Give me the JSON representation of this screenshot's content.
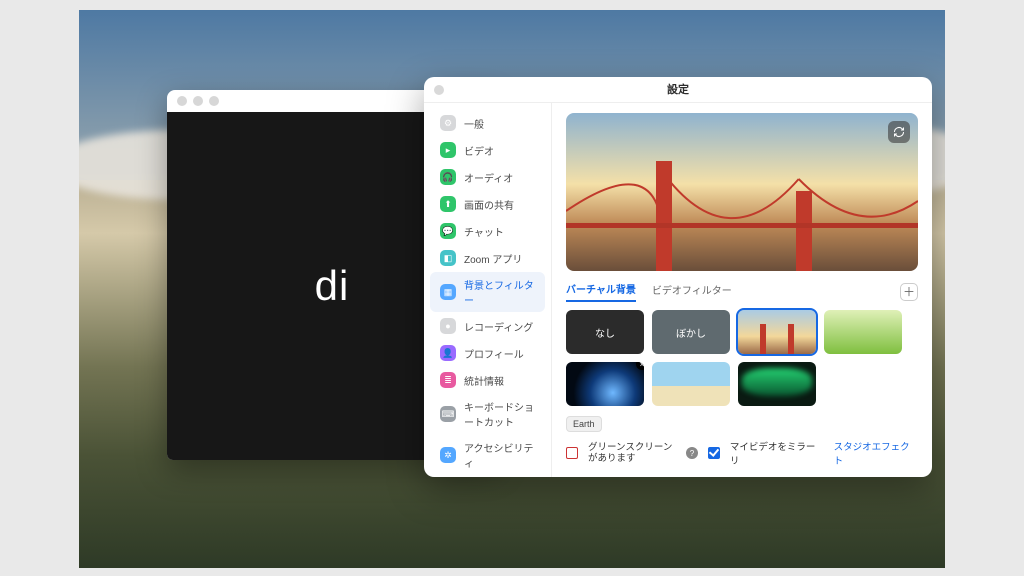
{
  "desktop": {
    "visible_text": "di"
  },
  "settings": {
    "title": "設定",
    "sidebar": {
      "items": [
        {
          "label": "一般",
          "icon_bg": "#d7d8da",
          "glyph": "⚙"
        },
        {
          "label": "ビデオ",
          "icon_bg": "#2fc56a",
          "glyph": "▸"
        },
        {
          "label": "オーディオ",
          "icon_bg": "#2fc56a",
          "glyph": "🎧"
        },
        {
          "label": "画面の共有",
          "icon_bg": "#2fc56a",
          "glyph": "⬆"
        },
        {
          "label": "チャット",
          "icon_bg": "#2fc56a",
          "glyph": "💬"
        },
        {
          "label": "Zoom アプリ",
          "icon_bg": "#45c3c8",
          "glyph": "◧"
        },
        {
          "label": "背景とフィルター",
          "icon_bg": "#54a7ff",
          "glyph": "▦",
          "active": true
        },
        {
          "label": "レコーディング",
          "icon_bg": "#d7d8da",
          "glyph": "●"
        },
        {
          "label": "プロフィール",
          "icon_bg": "#9a6bff",
          "glyph": "👤"
        },
        {
          "label": "統計情報",
          "icon_bg": "#e85aa0",
          "glyph": "≣"
        },
        {
          "label": "キーボードショートカット",
          "icon_bg": "#9aa0a6",
          "glyph": "⌨"
        },
        {
          "label": "アクセシビリティ",
          "icon_bg": "#54a7ff",
          "glyph": "✲"
        }
      ]
    },
    "tabs": {
      "virtual_bg": "バーチャル背景",
      "video_filters": "ビデオフィルター"
    },
    "thumbs": {
      "none": "なし",
      "blur": "ぼかし",
      "tooltip": "Earth"
    },
    "footer": {
      "green_screen": "グリーンスクリーンがあります",
      "mirror": "マイビデオをミラーリ",
      "studio": "スタジオエフェクト"
    }
  }
}
